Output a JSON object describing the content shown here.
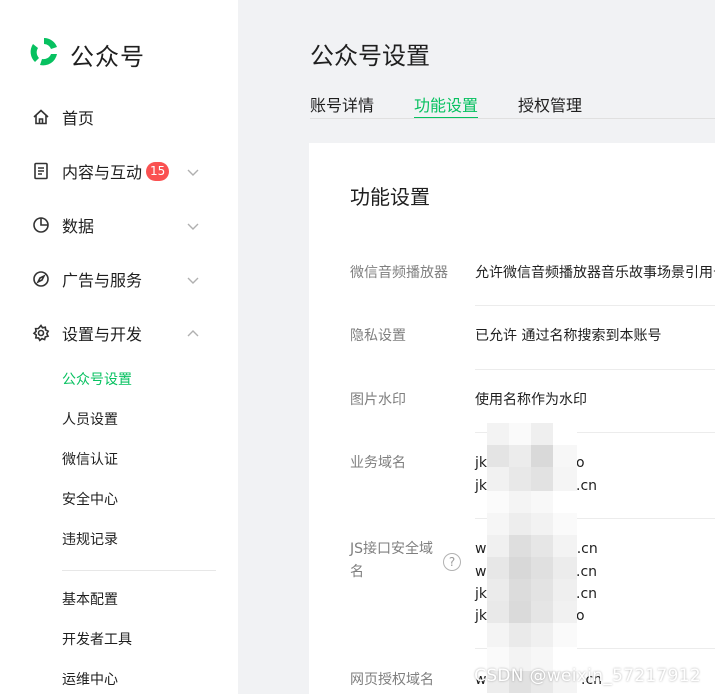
{
  "brand": {
    "name": "公众号",
    "accent": "#07c160"
  },
  "nav": [
    {
      "label": "首页",
      "icon": "home-icon"
    },
    {
      "label": "内容与互动",
      "icon": "document-icon",
      "badge": "15"
    },
    {
      "label": "数据",
      "icon": "pie-chart-icon"
    },
    {
      "label": "广告与服务",
      "icon": "compass-icon"
    },
    {
      "label": "设置与开发",
      "icon": "gear-icon",
      "expanded": true
    }
  ],
  "settings_sub": [
    "公众号设置",
    "人员设置",
    "微信认证",
    "安全中心",
    "违规记录"
  ],
  "dev_sub": [
    "基本配置",
    "开发者工具",
    "运维中心"
  ],
  "page": {
    "title": "公众号设置"
  },
  "tabs": [
    {
      "label": "账号详情",
      "active": false
    },
    {
      "label": "功能设置",
      "active": true
    },
    {
      "label": "授权管理",
      "active": false
    }
  ],
  "card": {
    "title": "功能设置",
    "rows": [
      {
        "label": "微信音频播放器",
        "value": "允许微信音频播放器音乐故事场景引用号"
      },
      {
        "label": "隐私设置",
        "value": "已允许 通过名称搜索到本账号"
      },
      {
        "label": "图片水印",
        "value": "使用名称作为水印"
      },
      {
        "label": "业务域名",
        "values": [
          "jk",
          "o",
          "jk",
          ".cn"
        ]
      },
      {
        "label": "JS接口安全域名",
        "values": [
          "w",
          "c.cn",
          "w",
          ".cn",
          "jk",
          ".cn",
          "jk",
          "o"
        ]
      },
      {
        "label": "网页授权域名",
        "values": [
          "w",
          ".cn"
        ]
      }
    ],
    "help": "?"
  },
  "watermark": "CSDN @weixin_57217912"
}
